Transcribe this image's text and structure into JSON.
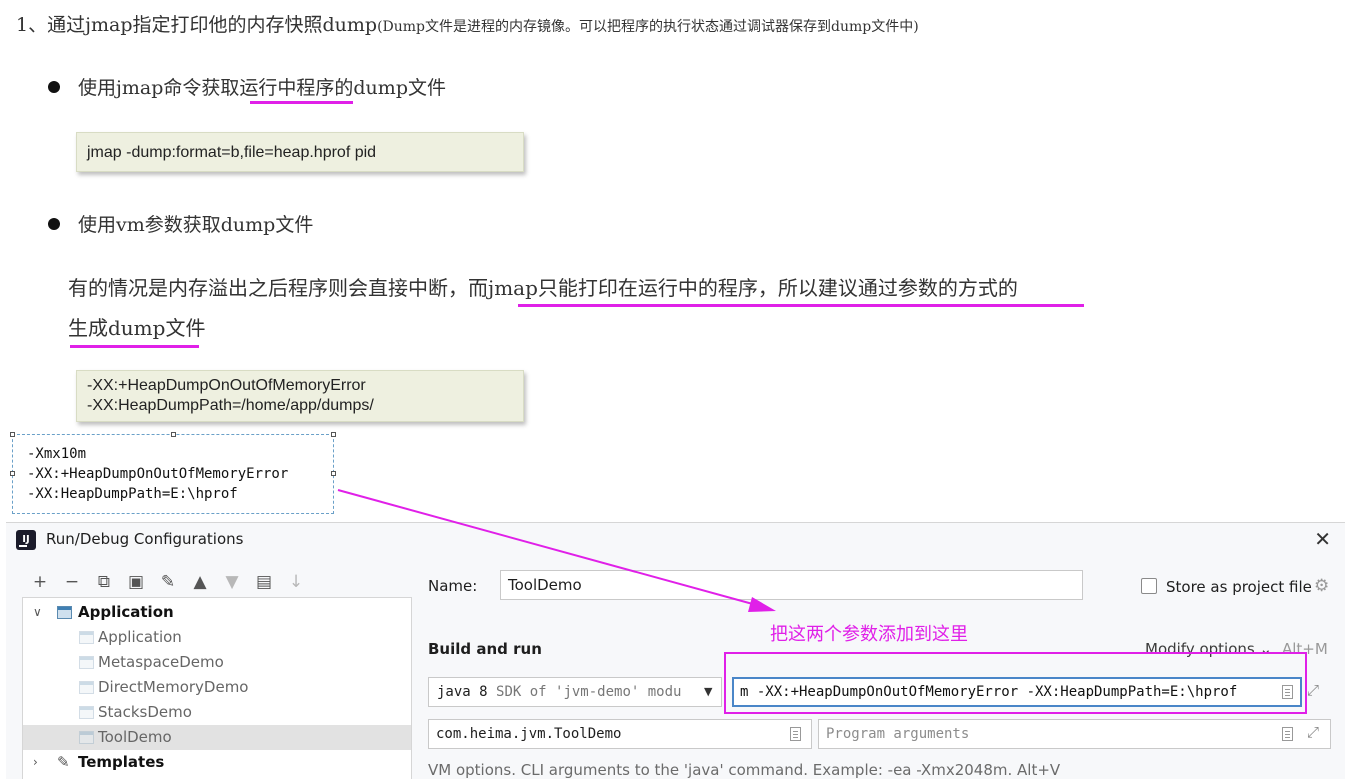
{
  "doc": {
    "heading_main": "1、通过jmap指定打印他的内存快照dump",
    "heading_note": "(Dump文件是进程的内存镜像。可以把程序的执行状态通过调试器保存到dump文件中)",
    "bullet1": "使用jmap命令获取运行中程序的dump文件",
    "code1": "jmap -dump:format=b,file=heap.hprof pid",
    "bullet2": "使用vm参数获取dump文件",
    "para_line1": "有的情况是内存溢出之后程序则会直接中断，而jmap只能打印在运行中的程序，所以建议通过参数的方式的",
    "para_line2": "生成dump文件",
    "code2": [
      "-XX:+HeapDumpOnOutOfMemoryError",
      "-XX:HeapDumpPath=/home/app/dumps/"
    ],
    "selection_lines": [
      "-Xmx10m",
      "-XX:+HeapDumpOnOutOfMemoryError",
      "-XX:HeapDumpPath=E:\\hprof"
    ]
  },
  "annotation": {
    "text": "把这两个参数添加到这里",
    "color": "#e020e8"
  },
  "dialog": {
    "title": "Run/Debug Configurations",
    "close_icon": "close-icon",
    "toolbar": [
      {
        "name": "add-icon",
        "glyph": "+",
        "enabled": true
      },
      {
        "name": "remove-icon",
        "glyph": "−",
        "enabled": true
      },
      {
        "name": "copy-icon",
        "glyph": "⧉",
        "enabled": true
      },
      {
        "name": "save-icon",
        "glyph": "▣",
        "enabled": true
      },
      {
        "name": "wrench-icon",
        "glyph": "🔧",
        "enabled": true
      },
      {
        "name": "move-up-icon",
        "glyph": "▲",
        "enabled": true
      },
      {
        "name": "move-down-icon",
        "glyph": "▼",
        "enabled": false
      },
      {
        "name": "new-folder-icon",
        "glyph": "▤",
        "enabled": true
      },
      {
        "name": "sort-icon",
        "glyph": "↓",
        "enabled": false
      }
    ],
    "tree": {
      "group": "Application",
      "items": [
        "Application",
        "MetaspaceDemo",
        "DirectMemoryDemo",
        "StacksDemo",
        "ToolDemo"
      ],
      "selected": "ToolDemo",
      "templates": "Templates"
    },
    "name_label": "Name:",
    "name_value": "ToolDemo",
    "store_label": "Store as project file",
    "build_run_label": "Build and run",
    "modify_options": "Modify options",
    "modify_shortcut": "Alt+M",
    "sdk_prefix": "java 8",
    "sdk_rest": "SDK of 'jvm-demo' modu",
    "vm_options_value": "m -XX:+HeapDumpOnOutOfMemoryError -XX:HeapDumpPath=E:\\hprof",
    "main_class_value": "com.heima.jvm.ToolDemo",
    "program_args_placeholder": "Program arguments",
    "hint": "VM options. CLI arguments to the 'java' command. Example: -ea -Xmx2048m. Alt+V"
  }
}
